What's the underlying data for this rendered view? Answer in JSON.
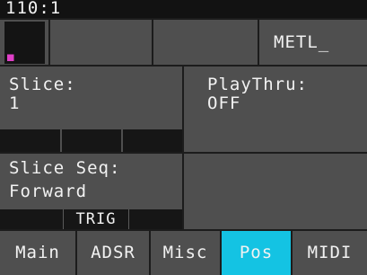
{
  "status": {
    "text": "110:1"
  },
  "header": {
    "pattern_icon": "grid-icon",
    "name_field": "METL_"
  },
  "params": {
    "slice": {
      "label": "Slice:",
      "value": "1"
    },
    "playthru": {
      "label": "PlayThru:",
      "value": "OFF"
    },
    "slice_seq": {
      "label": "Slice Seq:",
      "value": "Forward"
    },
    "trig_label": "TRIG"
  },
  "tabs": [
    {
      "label": "Main",
      "active": false
    },
    {
      "label": "ADSR",
      "active": false
    },
    {
      "label": "Misc",
      "active": false
    },
    {
      "label": "Pos",
      "active": true
    },
    {
      "label": "MIDI",
      "active": false
    }
  ],
  "colors": {
    "accent": "#14c3e3",
    "indicator": "#e040c8",
    "panel": "#4f4f4f",
    "background": "#1c1c1c"
  }
}
